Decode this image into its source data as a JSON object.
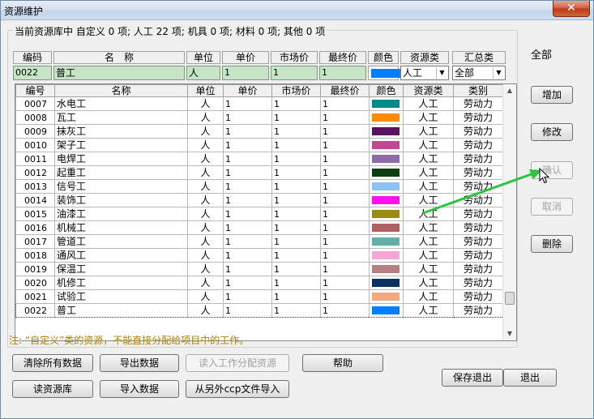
{
  "window": {
    "title": "资源维护",
    "close_label": "✕"
  },
  "summary": "当前资源库中 自定义 0 项; 人工 22 项; 机具 0 项; 材料 0 项; 其他 0 项",
  "columns": {
    "code": "编码",
    "name": "名　称",
    "unit": "单位",
    "price": "单价",
    "market_price": "市场价",
    "final_price": "最终价",
    "color": "颜色",
    "resource_type": "资源类",
    "summary_type": "汇总类"
  },
  "edit_row": {
    "code": "0022",
    "name": "普工",
    "unit": "人",
    "price": "1",
    "market_price": "1",
    "final_price": "1",
    "color": "#0080ff",
    "resource_type": "人工",
    "summary_type": "全部"
  },
  "table": {
    "headers": [
      "编号",
      "名称",
      "单位",
      "单价",
      "市场价",
      "最终价",
      "颜色",
      "资源类",
      "类别"
    ],
    "rows": [
      {
        "code": "0007",
        "name": "水电工",
        "unit": "人",
        "price": "1",
        "market": "1",
        "final": "1",
        "color": "#008b8b",
        "rtype": "人工",
        "category": "劳动力"
      },
      {
        "code": "0008",
        "name": "瓦工",
        "unit": "人",
        "price": "1",
        "market": "1",
        "final": "1",
        "color": "#ff8c00",
        "rtype": "人工",
        "category": "劳动力"
      },
      {
        "code": "0009",
        "name": "抹灰工",
        "unit": "人",
        "price": "1",
        "market": "1",
        "final": "1",
        "color": "#5b1060",
        "rtype": "人工",
        "category": "劳动力"
      },
      {
        "code": "0010",
        "name": "架子工",
        "unit": "人",
        "price": "1",
        "market": "1",
        "final": "1",
        "color": "#c04890",
        "rtype": "人工",
        "category": "劳动力"
      },
      {
        "code": "0011",
        "name": "电焊工",
        "unit": "人",
        "price": "1",
        "market": "1",
        "final": "1",
        "color": "#8f6aaa",
        "rtype": "人工",
        "category": "劳动力"
      },
      {
        "code": "0012",
        "name": "起重工",
        "unit": "人",
        "price": "1",
        "market": "1",
        "final": "1",
        "color": "#0a4010",
        "rtype": "人工",
        "category": "劳动力"
      },
      {
        "code": "0013",
        "name": "信号工",
        "unit": "人",
        "price": "1",
        "market": "1",
        "final": "1",
        "color": "#8ec2f2",
        "rtype": "人工",
        "category": "劳动力"
      },
      {
        "code": "0014",
        "name": "装饰工",
        "unit": "人",
        "price": "1",
        "market": "1",
        "final": "1",
        "color": "#ff10f0",
        "rtype": "人工",
        "category": "劳动力"
      },
      {
        "code": "0015",
        "name": "油漆工",
        "unit": "人",
        "price": "1",
        "market": "1",
        "final": "1",
        "color": "#9a8c10",
        "rtype": "人工",
        "category": "劳动力"
      },
      {
        "code": "0016",
        "name": "机械工",
        "unit": "人",
        "price": "1",
        "market": "1",
        "final": "1",
        "color": "#b06060",
        "rtype": "人工",
        "category": "劳动力"
      },
      {
        "code": "0017",
        "name": "管道工",
        "unit": "人",
        "price": "1",
        "market": "1",
        "final": "1",
        "color": "#60b0a8",
        "rtype": "人工",
        "category": "劳动力"
      },
      {
        "code": "0018",
        "name": "通风工",
        "unit": "人",
        "price": "1",
        "market": "1",
        "final": "1",
        "color": "#f4a8d8",
        "rtype": "人工",
        "category": "劳动力"
      },
      {
        "code": "0019",
        "name": "保温工",
        "unit": "人",
        "price": "1",
        "market": "1",
        "final": "1",
        "color": "#b88080",
        "rtype": "人工",
        "category": "劳动力"
      },
      {
        "code": "0020",
        "name": "机修工",
        "unit": "人",
        "price": "1",
        "market": "1",
        "final": "1",
        "color": "#083060",
        "rtype": "人工",
        "category": "劳动力"
      },
      {
        "code": "0021",
        "name": "试验工",
        "unit": "人",
        "price": "1",
        "market": "1",
        "final": "1",
        "color": "#f4a880",
        "rtype": "人工",
        "category": "劳动力"
      },
      {
        "code": "0022",
        "name": "普工",
        "unit": "人",
        "price": "1",
        "market": "1",
        "final": "1",
        "color": "#0080ff",
        "rtype": "人工",
        "category": "劳动力"
      }
    ]
  },
  "side": {
    "filter_label": "全部",
    "add": "增加",
    "modify": "修改",
    "confirm": "确认",
    "cancel": "取消",
    "delete": "删除"
  },
  "note": "注: “自定义”类的资源，不能直接分配给项目中的工作。",
  "bottom": {
    "clear_all": "清除所有数据",
    "export": "导出数据",
    "read_assignment": "读入工作分配资源",
    "help": "帮助",
    "read_library": "读资源库",
    "import": "导入数据",
    "import_ccp": "从另外ccp文件导入",
    "save_exit": "保存退出",
    "exit": "退出"
  },
  "colors": {
    "accent_arrow": "#2ec440"
  }
}
